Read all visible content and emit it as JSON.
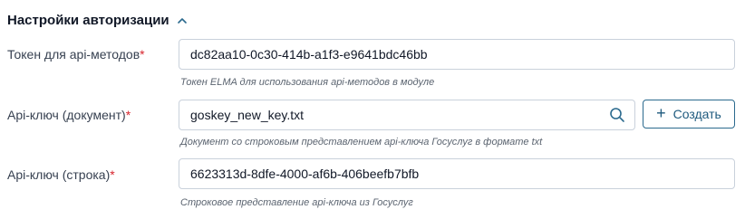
{
  "section": {
    "title": "Настройки авторизации"
  },
  "fields": [
    {
      "label": "Токен для api-методов",
      "required_mark": "*",
      "value": "dc82aa10-0c30-414b-a1f3-e9641bdc46bb",
      "hint": "Токен ELMA для использования api-методов в модуле"
    },
    {
      "label": "Api-ключ (документ)",
      "required_mark": "*",
      "value": "goskey_new_key.txt",
      "hint": "Документ со строковым представлением api-ключа Госуслуг в формате txt"
    },
    {
      "label": "Api-ключ (строка)",
      "required_mark": "*",
      "value": "6623313d-8dfe-4000-af6b-406beefb7bfb",
      "hint": "Строковое представление api-ключа из Госуслуг"
    }
  ],
  "buttons": {
    "create_label": "Создать"
  },
  "icons": {
    "collapse": "chevron-up-icon",
    "search": "search-icon",
    "create": "plus-icon"
  },
  "colors": {
    "required": "#d7262e",
    "accent": "#1e5a7e",
    "border": "#c9d1db"
  }
}
